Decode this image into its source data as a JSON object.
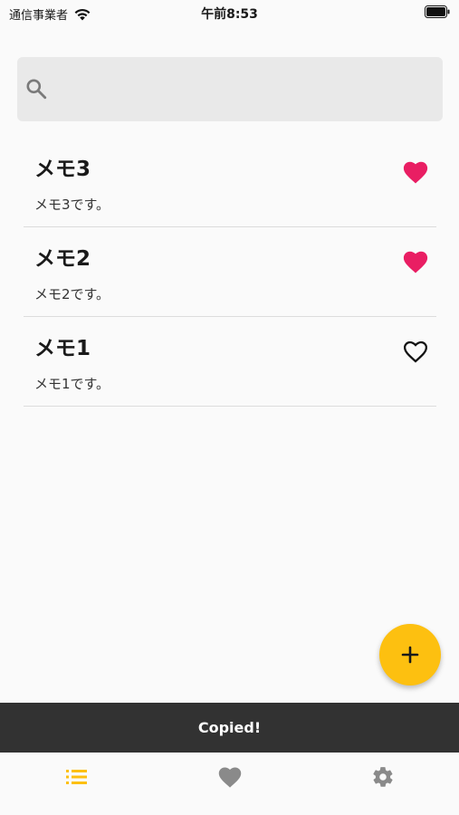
{
  "status_bar": {
    "carrier": "通信事業者",
    "time": "午前8:53"
  },
  "search": {
    "placeholder": ""
  },
  "memos": [
    {
      "title": "メモ3",
      "body": "メモ3です。",
      "favorite": true
    },
    {
      "title": "メモ2",
      "body": "メモ2です。",
      "favorite": true
    },
    {
      "title": "メモ1",
      "body": "メモ1です。",
      "favorite": false
    }
  ],
  "snackbar": {
    "message": "Copied!"
  },
  "bottom_nav": {
    "items": [
      {
        "icon": "list-icon",
        "active": true
      },
      {
        "icon": "heart-icon",
        "active": false
      },
      {
        "icon": "gear-icon",
        "active": false
      }
    ]
  },
  "colors": {
    "accent": "#fdc010",
    "favorite": "#e91e63",
    "nav_inactive": "#8a8a8a",
    "snackbar_bg": "#323232"
  }
}
